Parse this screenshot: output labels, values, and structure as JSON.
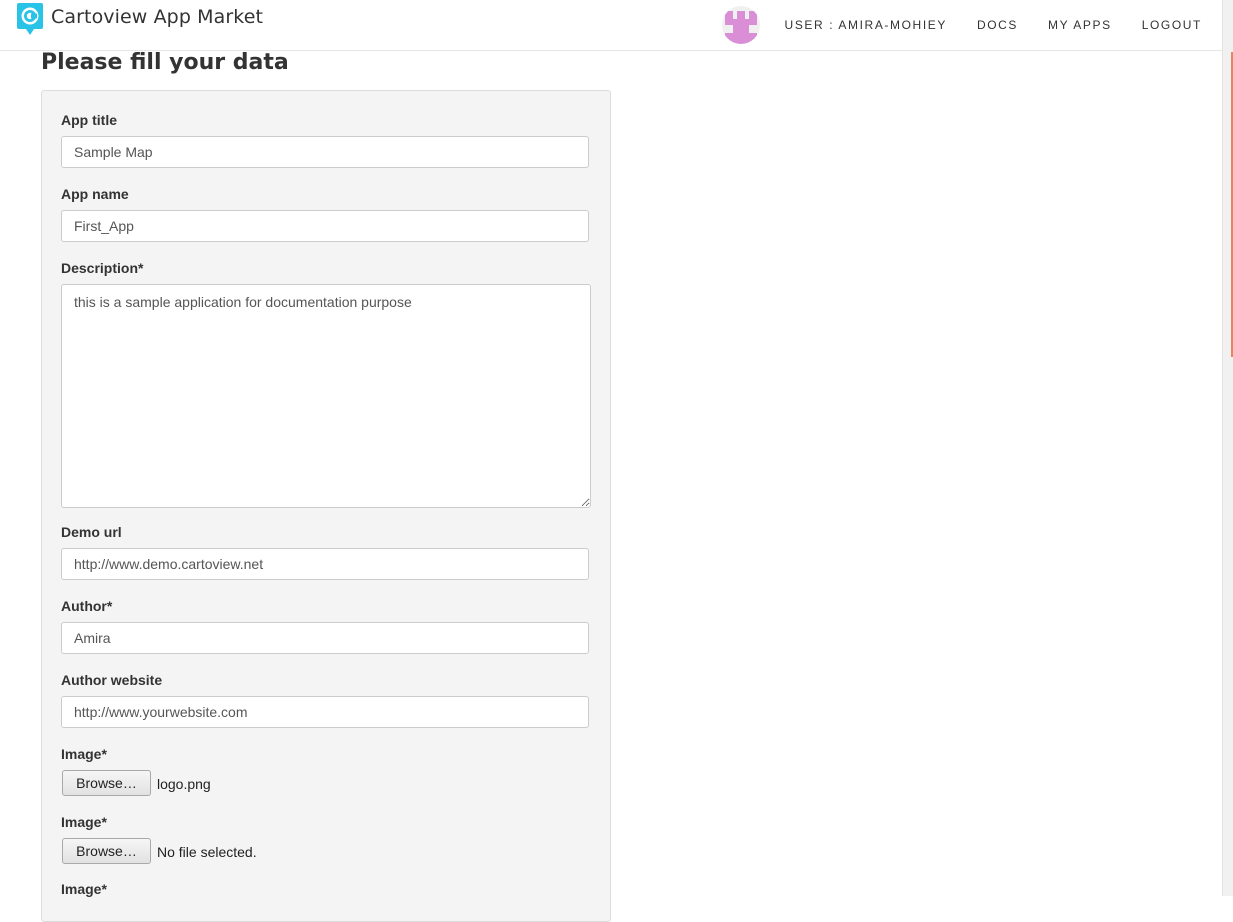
{
  "app": {
    "brand": "Cartoview App Market"
  },
  "nav": {
    "user_label": "USER : AMIRA-MOHIEY",
    "docs_label": "DOCS",
    "myapps_label": "MY APPS",
    "logout_label": "LOGOUT"
  },
  "colors": {
    "brand_logo": "#29c3e8",
    "scroll_accent": "#e8855c",
    "avatar": "#d98ed6"
  },
  "page": {
    "title": "Please fill your data"
  },
  "form": {
    "app_title": {
      "label": "App title",
      "value": "Sample Map"
    },
    "app_name": {
      "label": "App name",
      "value": "First_App"
    },
    "description": {
      "label": "Description*",
      "value": "this is a sample application for documentation purpose"
    },
    "demo_url": {
      "label": "Demo url",
      "value": "http://www.demo.cartoview.net"
    },
    "author": {
      "label": "Author*",
      "value": "Amira"
    },
    "author_website": {
      "label": "Author website",
      "value": "http://www.yourwebsite.com"
    },
    "image1": {
      "label": "Image*",
      "button": "Browse…",
      "file": "logo.png"
    },
    "image2": {
      "label": "Image*",
      "button": "Browse…",
      "file": "No file selected."
    },
    "image3": {
      "label": "Image*"
    }
  }
}
